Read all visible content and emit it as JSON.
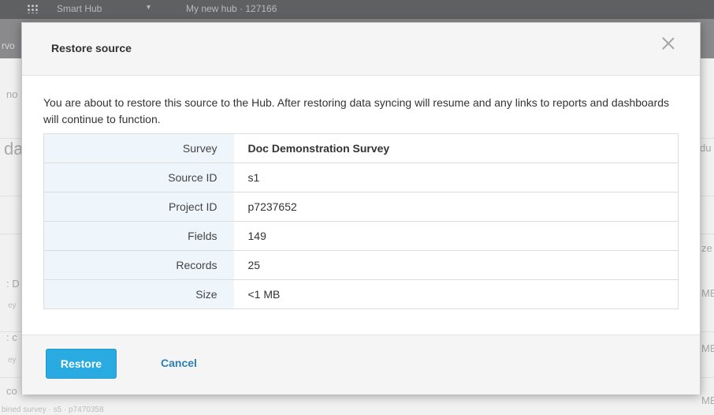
{
  "background": {
    "app_name": "Smart Hub",
    "breadcrumb": "My new hub · 127166",
    "nav_fragment": "rvo",
    "fragments": {
      "left_no": "no",
      "left_da": "da",
      "left_d": ": D",
      "left_ey1": "ey",
      "left_c1": ": c",
      "left_ey2": "ey",
      "left_co": "co",
      "left_bottom": "bined survey · s5 · p7470358",
      "right_du": "du",
      "right_ze": "ze",
      "right_mb1": "MB",
      "right_mb2": "MB",
      "right_mb3": "MB"
    }
  },
  "modal": {
    "title": "Restore source",
    "message": "You are about to restore this source to the Hub. After restoring data syncing will resume and any links to reports and dashboards will continue to function.",
    "details": [
      {
        "label": "Survey",
        "value": "Doc Demonstration Survey"
      },
      {
        "label": "Source ID",
        "value": "s1"
      },
      {
        "label": "Project ID",
        "value": "p7237652"
      },
      {
        "label": "Fields",
        "value": "149"
      },
      {
        "label": "Records",
        "value": "25"
      },
      {
        "label": "Size",
        "value": "<1 MB"
      }
    ],
    "restore_label": "Restore",
    "cancel_label": "Cancel",
    "close_icon": "close-icon"
  },
  "colors": {
    "primary_button": "#29abe2",
    "link": "#2a7fb8",
    "key_cell_bg": "#eef5fb"
  }
}
